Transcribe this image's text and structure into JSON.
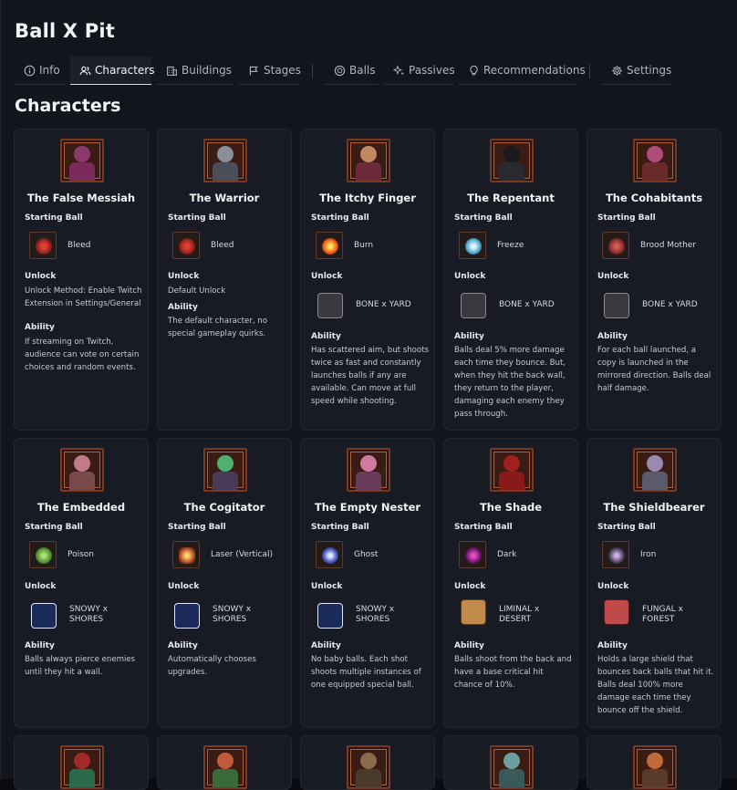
{
  "app": {
    "title": "Ball X Pit"
  },
  "tabs": [
    {
      "label": "Info",
      "icon": "info-icon"
    },
    {
      "label": "Characters",
      "icon": "users-icon"
    },
    {
      "label": "Buildings",
      "icon": "buildings-icon"
    },
    {
      "label": "Stages",
      "icon": "flag-icon"
    },
    {
      "label": "Balls",
      "icon": "ball-icon"
    },
    {
      "label": "Passives",
      "icon": "sparkles-icon"
    },
    {
      "label": "Recommendations",
      "icon": "lightbulb-icon"
    },
    {
      "label": "Settings",
      "icon": "gear-icon"
    }
  ],
  "active_tab": "Characters",
  "section": {
    "title": "Characters"
  },
  "labels": {
    "starting_ball": "Starting Ball",
    "unlock": "Unlock",
    "ability": "Ability"
  },
  "characters": [
    {
      "name": "The False Messiah",
      "ball": "Bleed",
      "unlock": "Unlock Method: Enable Twitch Extension in Settings/General",
      "ability": "If streaming on Twitch, audience can vote on certain choices and random events."
    },
    {
      "name": "The Warrior",
      "ball": "Bleed",
      "unlock": "Default Unlock",
      "ability": "The default character, no special gameplay quirks."
    },
    {
      "name": "The Itchy Finger",
      "ball": "Burn",
      "unlock": "BONE x YARD",
      "ability": "Has scattered aim, but shoots twice as fast and constantly launches balls if any are available. Can move at full speed while shooting."
    },
    {
      "name": "The Repentant",
      "ball": "Freeze",
      "unlock": "BONE x YARD",
      "ability": "Balls deal 5% more damage each time they bounce. But, when they hit the back wall, they return to the player, damaging each enemy they pass through."
    },
    {
      "name": "The Cohabitants",
      "ball": "Brood Mother",
      "unlock": "BONE x YARD",
      "ability": "For each ball launched, a copy is launched in the mirrored direction. Balls deal half damage."
    },
    {
      "name": "The Embedded",
      "ball": "Poison",
      "unlock": "SNOWY x SHORES",
      "ability": "Balls always pierce enemies until they hit a wall."
    },
    {
      "name": "The Cogitator",
      "ball": "Laser (Vertical)",
      "unlock": "SNOWY x SHORES",
      "ability": "Automatically chooses upgrades."
    },
    {
      "name": "The Empty Nester",
      "ball": "Ghost",
      "unlock": "SNOWY x SHORES",
      "ability": "No baby balls. Each shot shoots multiple instances of one equipped special ball."
    },
    {
      "name": "The Shade",
      "ball": "Dark",
      "unlock": "LIMINAL x DESERT",
      "ability": "Balls shoot from the back and have a base critical hit chance of 10%."
    },
    {
      "name": "The Shieldbearer",
      "ball": "Iron",
      "unlock": "FUNGAL x FOREST",
      "ability": "Holds a large shield that bounces back balls that hit it. Balls deal 100% more damage each time they bounce off the shield."
    }
  ],
  "colors": {
    "background": "#12151c",
    "card": "#181b23",
    "portrait_frame": "#7a3a22",
    "text": "#e6e8ee"
  }
}
